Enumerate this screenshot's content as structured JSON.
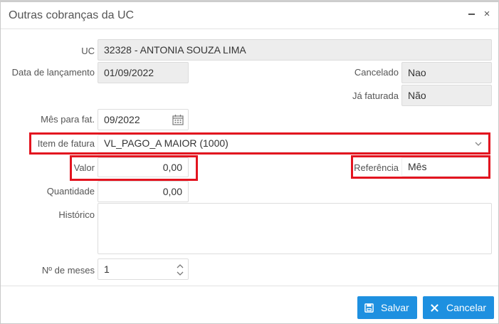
{
  "dialog": {
    "title": "Outras cobranças da UC",
    "minimize_icon": "minimize-icon",
    "close_icon": "close-icon",
    "close_glyph": "×"
  },
  "form": {
    "uc_label": "UC",
    "uc_value": "32328  - ANTONIA SOUZA LIMA",
    "data_lancamento_label": "Data de lançamento",
    "data_lancamento_value": "01/09/2022",
    "cancelado_label": "Cancelado",
    "cancelado_value": "Nao",
    "ja_faturada_label": "Já faturada",
    "ja_faturada_value": "Não",
    "mes_fat_label": "Mês para fat.",
    "mes_fat_value": "09/2022",
    "item_fatura_label": "Item de fatura",
    "item_fatura_value": "VL_PAGO_A MAIOR (1000)",
    "valor_label": "Valor",
    "valor_value": "0,00",
    "referencia_label": "Referência",
    "referencia_value": "Mês",
    "quantidade_label": "Quantidade",
    "quantidade_value": "0,00",
    "historico_label": "Histórico",
    "historico_value": "",
    "num_meses_label": "Nº de meses",
    "num_meses_value": "1"
  },
  "footer": {
    "save_label": "Salvar",
    "cancel_label": "Cancelar"
  },
  "colors": {
    "accent": "#1e90e0",
    "highlight": "#e3141f",
    "readonly_bg": "#ededed"
  }
}
